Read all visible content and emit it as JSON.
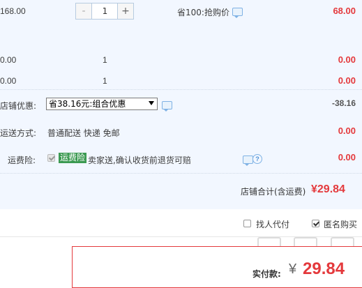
{
  "colors": {
    "price_red": "#e4393c",
    "panel_bg": "#f2f7ff",
    "tag_green": "#3c9a52",
    "link_blue": "#4a8fd6"
  },
  "items": [
    {
      "unit_price": "168.00",
      "quantity": "1",
      "promo": "省100:抢购价",
      "subtotal": "68.00"
    },
    {
      "unit_price": "0.00",
      "quantity": "1",
      "subtotal": "0.00"
    },
    {
      "unit_price": "0.00",
      "quantity": "1",
      "subtotal": "0.00"
    }
  ],
  "stepper": {
    "minus": "-",
    "plus": "+"
  },
  "discount": {
    "label": "店铺优惠:",
    "selected": "省38.16元:组合优惠",
    "amount": "-38.16"
  },
  "shipping": {
    "label": "运送方式:",
    "text": "普通配送 快递 免邮",
    "amount": "0.00"
  },
  "insurance": {
    "label": "运费险:",
    "tag": "运费险",
    "text": "卖家送,确认收货前退货可赔",
    "amount": "0.00",
    "help": "?"
  },
  "store_total": {
    "label": "店铺合计(含运费)",
    "amount": "¥29.84"
  },
  "options": {
    "proxy_pay": "找人代付",
    "anonymous": "匿名购买"
  },
  "payment": {
    "label": "实付款:",
    "currency": "¥",
    "amount": "29.84"
  }
}
